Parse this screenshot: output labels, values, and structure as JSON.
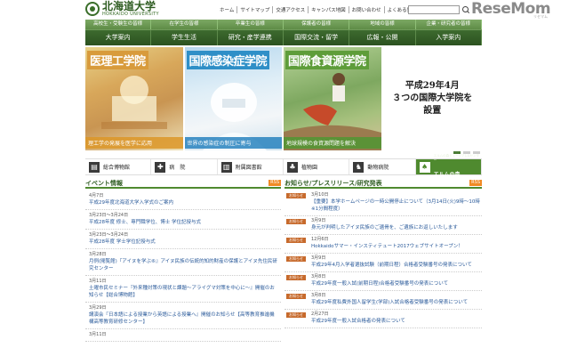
{
  "header": {
    "logo_jp": "北海道大学",
    "logo_en": "HOKKAIDO UNIVERSITY",
    "utility_links": [
      "ホーム",
      "サイトマップ",
      "交通アクセス",
      "キャンパス地図",
      "お問い合わせ",
      "よくある質問"
    ],
    "brand": "ReseMom",
    "brand_sub": "リセマム"
  },
  "audience_nav": [
    "高校生・受験生の皆様",
    "在学生の皆様",
    "卒業生の皆様",
    "保護者の皆様",
    "地域の皆様",
    "企業・研究者の皆様"
  ],
  "main_nav": [
    "大学案内",
    "学生生活",
    "研究・産学連携",
    "国際交流・留学",
    "広報・公開",
    "入学案内"
  ],
  "banner": {
    "panels": [
      {
        "title": "医理工学院",
        "caption": "理工学の発展を医学に応用"
      },
      {
        "title": "国際感染症学院",
        "caption": "世界の感染症の制圧に寄与"
      },
      {
        "title": "国際食資源学院",
        "caption": "地球規模の食資源問題を解決"
      }
    ],
    "announce_lines": [
      "平成29年4月",
      "３つの国際大学院を",
      "設置"
    ]
  },
  "facilities": [
    {
      "icon": "museum-icon",
      "label": "総合博物館"
    },
    {
      "icon": "hospital-icon",
      "label": "病　院"
    },
    {
      "icon": "library-icon",
      "label": "附属図書館"
    },
    {
      "icon": "botanic-icon",
      "label": "植物園"
    },
    {
      "icon": "animal-icon",
      "label": "動物病院"
    },
    {
      "icon": "elm-icon",
      "label": "エルムの森",
      "sub": "エルムの森ミュージアム&センター"
    }
  ],
  "events": {
    "title": "イベント情報",
    "rss": "RSS",
    "items": [
      {
        "date": "4月7日",
        "text": "平成29年度北海道大学入学式のご案内"
      },
      {
        "date": "3月23日～3月24日",
        "text": "平成28年度 修士、専門職学位、博士 学位記授与式"
      },
      {
        "date": "3月23日～3月24日",
        "text": "平成28年度 学士学位記授与式"
      },
      {
        "date": "3月28日",
        "text": "月例(閲覧館)『アイヌを学ぶ⑥』アイヌ民族の伝統的知的財産の保護とアイヌ先住民研究センター"
      },
      {
        "date": "3月11日",
        "text": "土曜市民セミナー『外来種対策の現状と課題～アライグマ対策を中心に～』開催のお知らせ【総合博物館】"
      },
      {
        "date": "3月29日",
        "text": "講演会『日本語による授業から英語による授業へ』開催のお知らせ【高等教育推進機構高等教育研修センター】"
      },
      {
        "date": "3月11日",
        "text": ""
      }
    ]
  },
  "news": {
    "title": "お知らせ/プレスリリース/研究発表",
    "rss": "RSS",
    "items": [
      {
        "cat": "お知らせ",
        "date": "3月10日",
        "text": "【重要】本学ホームページの一時公開停止について（3月14日(火)9時～10時※1分間程度）"
      },
      {
        "cat": "お知らせ",
        "date": "3月9日",
        "text": "身元が判明したアイヌ民族のご遺骨を、ご遺族にお返しいたします"
      },
      {
        "cat": "お知らせ",
        "date": "12月6日",
        "text": "Hokkaidoサマー・インスティテュート2017ウェブサイトオープン！"
      },
      {
        "cat": "お知らせ",
        "date": "3月9日",
        "text": "平成29年4月入学者選抜試験（前期日程）合格者受験番号の発表について"
      },
      {
        "cat": "お知らせ",
        "date": "3月8日",
        "text": "平成29年度一般入試(前期日程)合格者受験番号の発表について"
      },
      {
        "cat": "お知らせ",
        "date": "3月8日",
        "text": "平成29年度私費外国人留学生(学部)入試合格者受験番号の発表について"
      },
      {
        "cat": "お知らせ",
        "date": "2月27日",
        "text": "平成29年度一般入試合格者の発表について"
      }
    ]
  }
}
